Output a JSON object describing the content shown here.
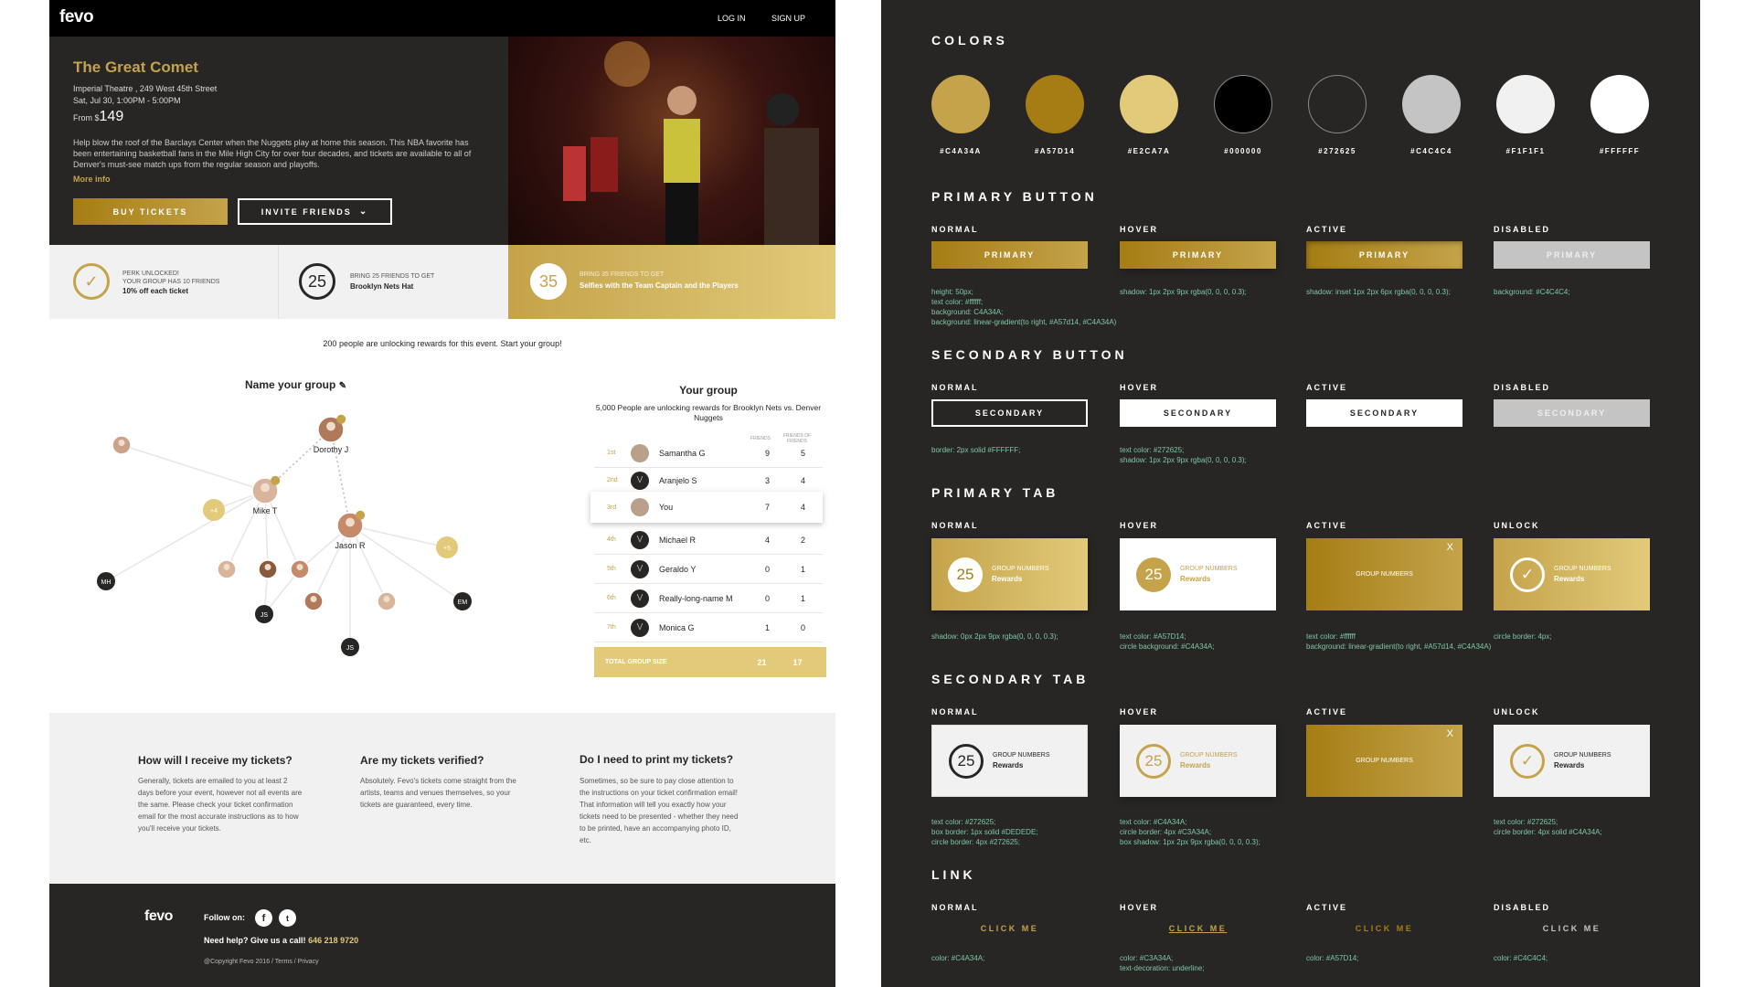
{
  "nav": {
    "logo": "fevo",
    "login": "LOG IN",
    "signup": "SIGN UP"
  },
  "hero": {
    "title": "The Great Comet",
    "venue": "Imperial Theatre , 249 West 45th Street",
    "date": "Sat, Jul 30, 1:00PM - 5:00PM",
    "from": "From $",
    "price": "149",
    "description": "Help blow the roof of the Barclays Center when the Nuggets play at home this season. This NBA favorite has been entertaining basketball fans in the Mile High City for over four decades, and tickets are available to all of Denver's must-see match ups from the regular season and playoffs.",
    "more_info": "More info",
    "buy": "BUY TICKETS",
    "invite": "INVITE FRIENDS"
  },
  "perks": [
    {
      "l1": "PERK UNLOCKED!",
      "l2": "YOUR GROUP HAS 10 FRIENDS",
      "l3": "10% off each ticket"
    },
    {
      "num": "25",
      "l1": "BRING 25 FRIENDS TO GET",
      "l2": "Brooklyn Nets Hat"
    },
    {
      "num": "35",
      "l1": "BRING 35 FRIENDS TO GET",
      "l2": "Selfies with the Team Captain and the Players"
    }
  ],
  "unlocking_text": "200 people are unlocking rewards for this event. Start your group!",
  "graph": {
    "title": "Name your group",
    "nodes": [
      {
        "label": "",
        "initials": "",
        "type": "photo"
      },
      {
        "label": "Dorothy J",
        "initials": "",
        "type": "photo"
      },
      {
        "label": "Mike T",
        "initials": "",
        "type": "photo"
      },
      {
        "label": "",
        "initials": "+4",
        "type": "more"
      },
      {
        "label": "Jason R",
        "initials": "",
        "type": "photo"
      },
      {
        "label": "",
        "initials": "+5",
        "type": "more"
      },
      {
        "label": "",
        "initials": "MH",
        "type": "initials"
      },
      {
        "label": "",
        "initials": "",
        "type": "photo"
      },
      {
        "label": "",
        "initials": "",
        "type": "photo"
      },
      {
        "label": "",
        "initials": "",
        "type": "photo"
      },
      {
        "label": "",
        "initials": "JS",
        "type": "initials"
      },
      {
        "label": "",
        "initials": "",
        "type": "photo"
      },
      {
        "label": "",
        "initials": "",
        "type": "photo"
      },
      {
        "label": "",
        "initials": "EM",
        "type": "initials"
      },
      {
        "label": "",
        "initials": "JS",
        "type": "initials"
      }
    ]
  },
  "group": {
    "title": "Your group",
    "subtitle": "5,000 People are unlocking rewards for Brooklyn Nets vs. Denver Nuggets",
    "col_friends": "FRIENDS",
    "col_fof": "FRIENDS OF FRIENDS",
    "rows": [
      {
        "rank": "1st",
        "name": "Samantha G",
        "friends": "9",
        "fof": "5"
      },
      {
        "rank": "2nd",
        "name": "Aranjelo S",
        "friends": "3",
        "fof": "4"
      },
      {
        "rank": "3rd",
        "name": "You",
        "friends": "7",
        "fof": "4"
      },
      {
        "rank": "4th",
        "name": "Michael R",
        "friends": "4",
        "fof": "2"
      },
      {
        "rank": "5th",
        "name": "Geraldo Y",
        "friends": "0",
        "fof": "1"
      },
      {
        "rank": "6th",
        "name": "Really-long-name M",
        "friends": "0",
        "fof": "1"
      },
      {
        "rank": "7th",
        "name": "Monica G",
        "friends": "1",
        "fof": "0"
      }
    ],
    "total_label": "TOTAL GROUP SIZE",
    "total_friends": "21",
    "total_fof": "17"
  },
  "faq": [
    {
      "q": "How will I receive my tickets?",
      "a": "Generally, tickets are emailed to you at least 2 days before your event, however not all events are the same. Please check your ticket confirmation email for the most accurate instructions as to how you'll receive your tickets."
    },
    {
      "q": "Are my tickets verified?",
      "a": "Absolutely. Fevo's tickets come straight from the artists, teams and venues themselves, so your tickets are guaranteed, every time."
    },
    {
      "q": "Do I need to print my tickets?",
      "a": "Sometimes, so be sure to pay close attention to the instructions on your ticket confirmation email! That information will tell you exactly how your tickets need to be presented - whether they need to be printed, have an accompanying photo ID, etc."
    }
  ],
  "footer": {
    "logo": "fevo",
    "follow": "Follow on:",
    "help": "Need help? Give us a call!",
    "phone": "646 218 9720",
    "copyright": "@Copyright Fevo 2016 / Terms / Privacy"
  },
  "guide": {
    "colors_title": "COLORS",
    "colors": [
      "#C4A34A",
      "#A57D14",
      "#E2CA7A",
      "#000000",
      "#272625",
      "#C4C4C4",
      "#F1F1F1",
      "#FFFFFF"
    ],
    "primary_button": {
      "title": "PRIMARY BUTTON",
      "states": [
        "NORMAL",
        "HOVER",
        "ACTIVE",
        "DISABLED"
      ],
      "label": "PRIMARY",
      "notes": [
        "height: 50px;\ntext color: #ffffff;\nbackground: C4A34A;\nbackground: linear-gradient(to right, #A57d14, #C4A34A)",
        "shadow: 1px 2px 9px rgba(0, 0, 0, 0.3);",
        "shadow: inset 1px 2px 6px rgba(0, 0, 0, 0.3);",
        "background: #C4C4C4;"
      ]
    },
    "secondary_button": {
      "title": "SECONDARY BUTTON",
      "states": [
        "NORMAL",
        "HOVER",
        "ACTIVE",
        "DISABLED"
      ],
      "label": "SECONDARY",
      "notes": [
        "border: 2px solid #FFFFFF;",
        "text color: #272625;\nshadow: 1px 2px 9px rgba(0, 0, 0, 0.3);",
        "",
        ""
      ]
    },
    "primary_tab": {
      "title": "PRIMARY TAB",
      "states": [
        "NORMAL",
        "HOVER",
        "ACTIVE",
        "UNLOCK"
      ],
      "num": "25",
      "l1": "GROUP NUMBERS",
      "l2": "Rewards",
      "notes": [
        "shadow: 0px 2px 9px rgba(0, 0, 0, 0.3);",
        "text color: #A57D14;\ncircle background: #C4A34A;",
        "text color: #ffffff\nbackground: linear-gradient(to right, #A57d14, #C4A34A)",
        "circle border: 4px;"
      ]
    },
    "secondary_tab": {
      "title": "SECONDARY TAB",
      "states": [
        "NORMAL",
        "HOVER",
        "ACTIVE",
        "UNLOCK"
      ],
      "num": "25",
      "l1": "GROUP NUMBERS",
      "l2": "Rewards",
      "notes": [
        "text color: #272625;\nbox border: 1px solid #DEDEDE;\ncircle border: 4px #272625;",
        "text color: #C4A34A;\ncircle border: 4px #C3A34A;\nbox shadow: 1px 2px 9px rgba(0, 0, 0, 0.3);",
        "",
        "text color: #272625;\ncircle border: 4px solid #C4A34A;"
      ]
    },
    "link": {
      "title": "LINK",
      "states": [
        "NORMAL",
        "HOVER",
        "ACTIVE",
        "DISABLED"
      ],
      "label": "CLICK ME",
      "notes": [
        "color: #C4A34A;",
        "color: #C3A34A;\ntext-decoration: underline;",
        "color: #A57D14;",
        "color: #C4C4C4;"
      ]
    },
    "close": "X",
    "check": "✓"
  }
}
